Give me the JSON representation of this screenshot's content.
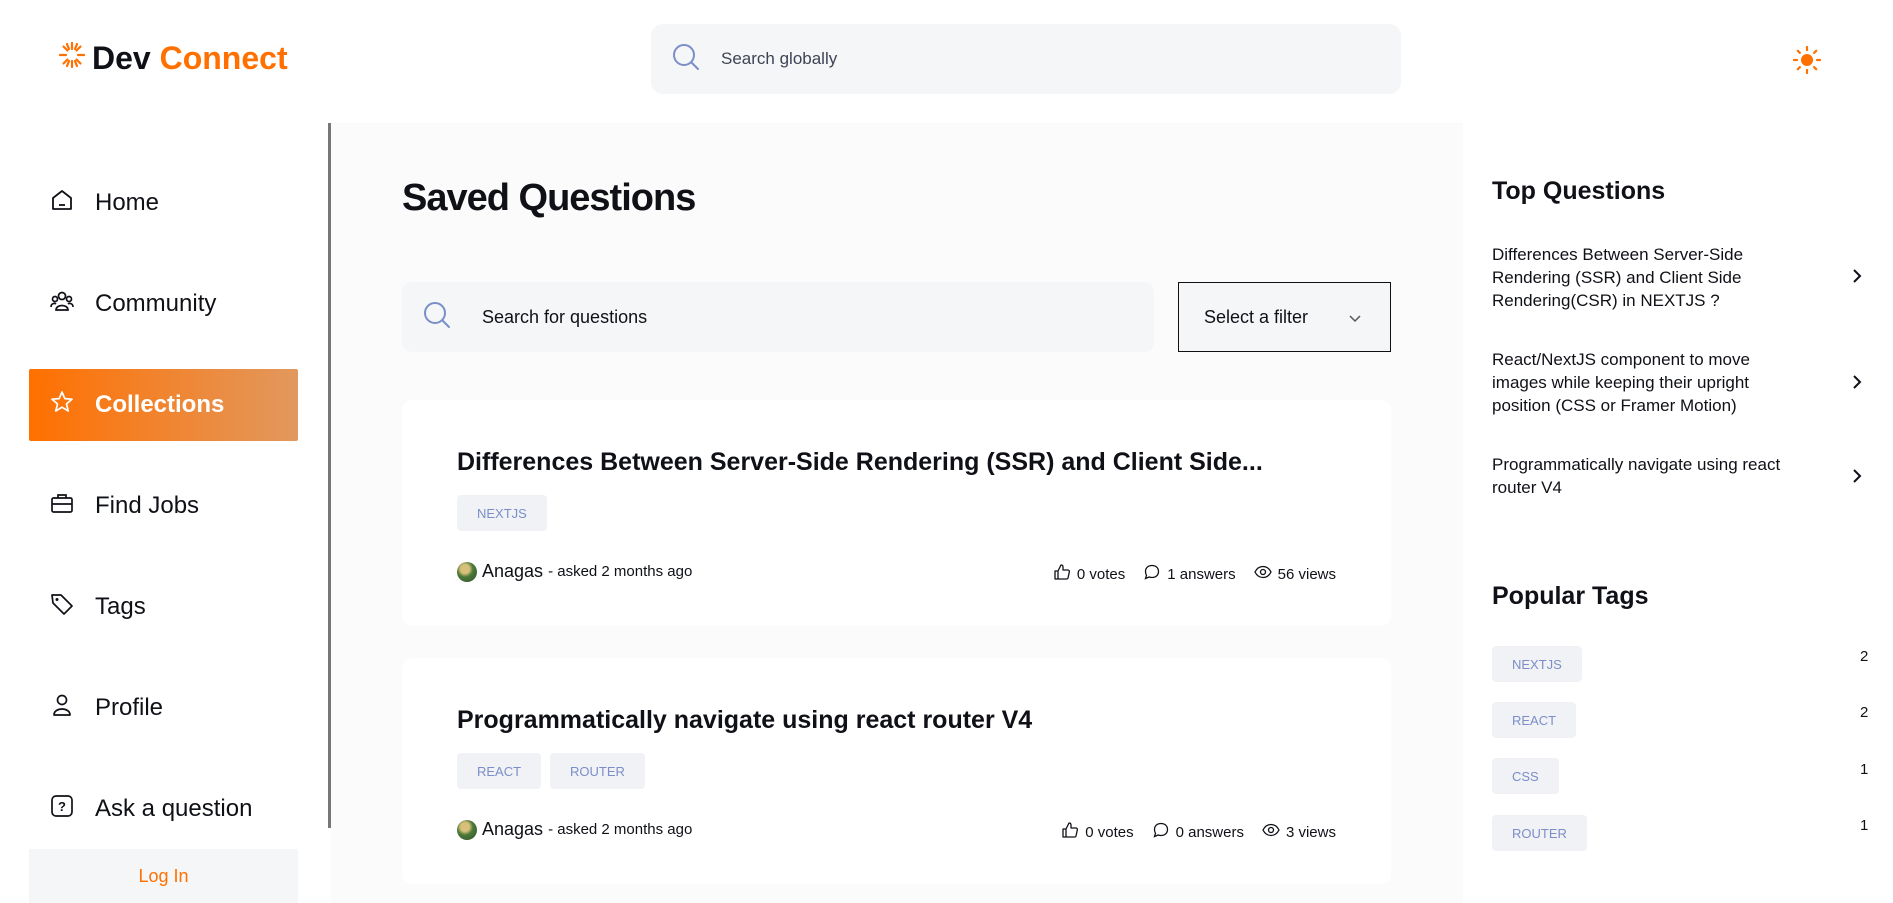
{
  "header": {
    "brand_part1": "Dev",
    "brand_part2": "Connect",
    "search_placeholder": "Search globally",
    "theme_icon": "sun-icon"
  },
  "sidebar": {
    "items": [
      {
        "label": "Home",
        "icon": "home-icon",
        "active": false
      },
      {
        "label": "Community",
        "icon": "users-icon",
        "active": false
      },
      {
        "label": "Collections",
        "icon": "star-icon",
        "active": true
      },
      {
        "label": "Find Jobs",
        "icon": "briefcase-icon",
        "active": false
      },
      {
        "label": "Tags",
        "icon": "tag-icon",
        "active": false
      },
      {
        "label": "Profile",
        "icon": "user-icon",
        "active": false
      },
      {
        "label": "Ask a question",
        "icon": "question-icon",
        "active": false
      }
    ],
    "login_label": "Log In"
  },
  "main": {
    "title": "Saved Questions",
    "search_placeholder": "Search for questions",
    "filter_label": "Select a filter",
    "questions": [
      {
        "title": "Differences Between Server-Side Rendering (SSR) and Client Side...",
        "tags": [
          "NEXTJS"
        ],
        "author": "Anagas",
        "asked": "- asked 2 months ago",
        "votes": "0 votes",
        "answers": "1 answers",
        "views": "56 views"
      },
      {
        "title": "Programmatically navigate using react router V4",
        "tags": [
          "REACT",
          "ROUTER"
        ],
        "author": "Anagas",
        "asked": "- asked 2 months ago",
        "votes": "0 votes",
        "answers": "0 answers",
        "views": "3 views"
      }
    ]
  },
  "rightbar": {
    "top_questions_heading": "Top Questions",
    "top_questions": [
      "Differences Between Server-Side Rendering (SSR) and Client Side Rendering(CSR) in NEXTJS ?",
      "React/NextJS component to move images while keeping their upright position (CSS or Framer Motion)",
      "Programmatically navigate using react router V4"
    ],
    "popular_tags_heading": "Popular Tags",
    "popular_tags": [
      {
        "name": "NEXTJS",
        "count": "2"
      },
      {
        "name": "REACT",
        "count": "2"
      },
      {
        "name": "CSS",
        "count": "1"
      },
      {
        "name": "ROUTER",
        "count": "1"
      }
    ]
  },
  "colors": {
    "accent": "#ff7000",
    "gradient_end": "#e2985e",
    "tag_text": "#7b8ec8",
    "surface": "#f4f6f8"
  }
}
